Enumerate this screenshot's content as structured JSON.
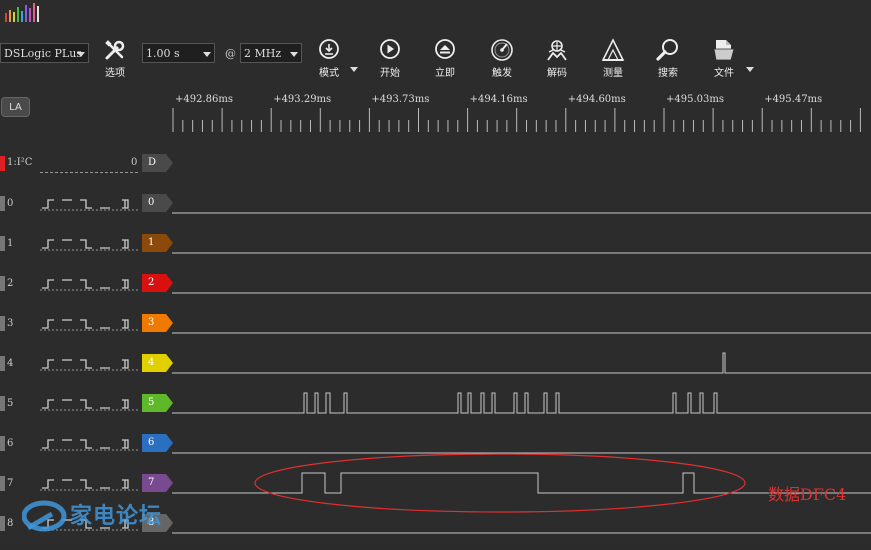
{
  "toolbar": {
    "device": "DSLogic PLus",
    "options_label": "选项",
    "duration": "1.00 s",
    "at": "@",
    "samplerate": "2 MHz",
    "mode_label": "模式",
    "start_label": "开始",
    "instant_label": "立即",
    "trigger_label": "触发",
    "decode_label": "解码",
    "measure_label": "测量",
    "search_label": "搜索",
    "file_label": "文件"
  },
  "la_label": "LA",
  "timeline": [
    "+492.86ms",
    "+493.29ms",
    "+493.73ms",
    "+494.16ms",
    "+494.60ms",
    "+495.03ms",
    "+495.47ms"
  ],
  "decoder": {
    "name": "1:I²C",
    "value": "0",
    "tag": "D"
  },
  "channels": [
    {
      "num": "0",
      "tag": "0",
      "color": "#4a4a4a"
    },
    {
      "num": "1",
      "tag": "1",
      "color": "#8b4a0a"
    },
    {
      "num": "2",
      "tag": "2",
      "color": "#d81010"
    },
    {
      "num": "3",
      "tag": "3",
      "color": "#f07a00"
    },
    {
      "num": "4",
      "tag": "4",
      "color": "#e0d000"
    },
    {
      "num": "5",
      "tag": "5",
      "color": "#5fb82a"
    },
    {
      "num": "6",
      "tag": "6",
      "color": "#2a6fc0"
    },
    {
      "num": "7",
      "tag": "7",
      "color": "#7a4a90"
    },
    {
      "num": "8",
      "tag": "8",
      "color": "#666666"
    }
  ],
  "annotation": "数据DFC4",
  "watermark": "家电论坛",
  "colors": {
    "background": "#2c2c2c",
    "wave": "#c8c8c8",
    "annotation": "#e03030"
  }
}
